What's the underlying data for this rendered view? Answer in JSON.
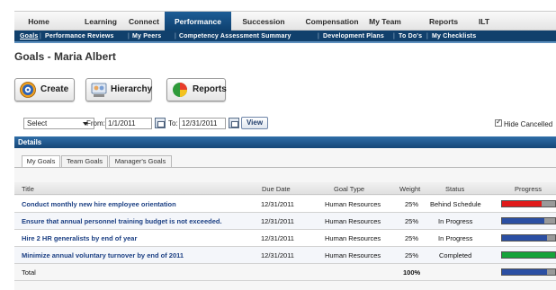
{
  "topnav": {
    "items": [
      {
        "label": "Home"
      },
      {
        "label": "Learning"
      },
      {
        "label": "Connect"
      },
      {
        "label": "Performance"
      },
      {
        "label": "Succession"
      },
      {
        "label": "Compensation"
      },
      {
        "label": "My Team"
      },
      {
        "label": "Reports"
      },
      {
        "label": "ILT"
      }
    ],
    "active": "Performance"
  },
  "subnav": {
    "items": [
      {
        "label": "Goals"
      },
      {
        "label": "Performance Reviews"
      },
      {
        "label": "My Peers"
      },
      {
        "label": "Competency Assessment Summary"
      },
      {
        "label": "Development Plans"
      },
      {
        "label": "To Do's"
      },
      {
        "label": "My Checklists"
      }
    ],
    "active": "Goals"
  },
  "page": {
    "title": "Goals - Maria Albert"
  },
  "actions": {
    "create": "Create",
    "hierarchy": "Hierarchy",
    "reports": "Reports"
  },
  "filters": {
    "select_value": "Select",
    "from_label": "From:",
    "from_value": "1/1/2011",
    "to_label": "To:",
    "to_value": "12/31/2011",
    "view_label": "View",
    "hide_cancelled_label": "Hide Cancelled",
    "hide_cancelled_checked": true
  },
  "details": {
    "header": "Details",
    "tabs": [
      {
        "label": "My Goals"
      },
      {
        "label": "Team Goals"
      },
      {
        "label": "Manager's Goals"
      }
    ],
    "active_tab": "My Goals"
  },
  "table": {
    "columns": [
      "Title",
      "Due Date",
      "Goal Type",
      "Weight",
      "Status",
      "Progress"
    ],
    "rows": [
      {
        "title": "Conduct monthly new hire employee orientation",
        "due": "12/31/2011",
        "type": "Human Resources",
        "weight": "25%",
        "status": "Behind Schedule",
        "progress": 0.75,
        "color": "#e01a1a"
      },
      {
        "title": "Ensure that annual personnel training budget is not exceeded.",
        "due": "12/31/2011",
        "type": "Human Resources",
        "weight": "25%",
        "status": "In Progress",
        "progress": 0.8,
        "color": "#2b4fa3"
      },
      {
        "title": "Hire 2 HR generalists by end of year",
        "due": "12/31/2011",
        "type": "Human Resources",
        "weight": "25%",
        "status": "In Progress",
        "progress": 0.85,
        "color": "#2b4fa3"
      },
      {
        "title": "Minimize annual voluntary turnover by end of 2011",
        "due": "12/31/2011",
        "type": "Human Resources",
        "weight": "25%",
        "status": "Completed",
        "progress": 1.0,
        "color": "#16a33a"
      }
    ],
    "total": {
      "label": "Total",
      "weight": "100%",
      "progress": 0.85,
      "color": "#2b4fa3"
    }
  }
}
